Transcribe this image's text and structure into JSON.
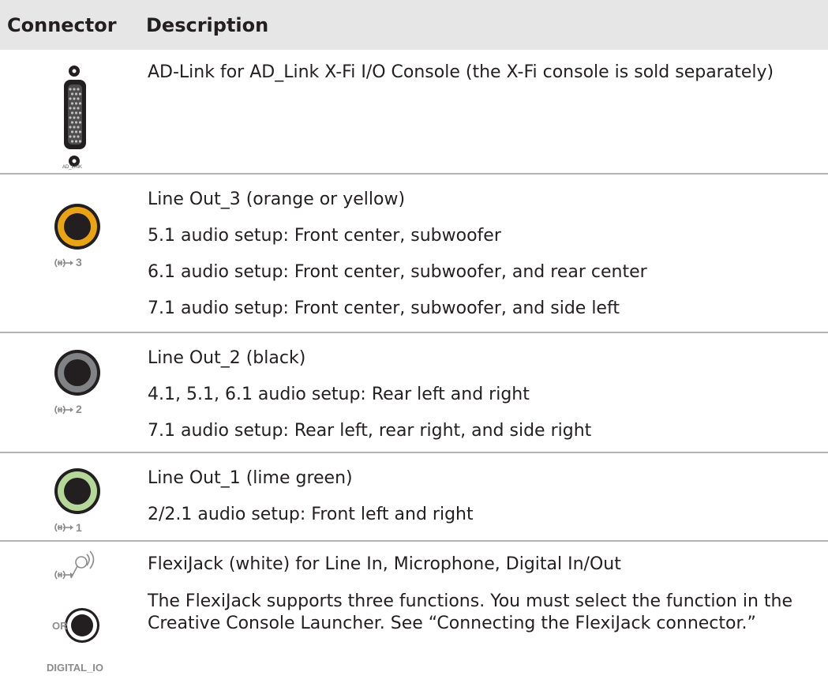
{
  "header": {
    "col_connector": "Connector",
    "col_description": "Description"
  },
  "rows": [
    {
      "icon": "ad-link-connector-icon",
      "icon_label": "AD_LINK",
      "lines": [
        "AD-Link for AD_Link X-Fi I/O Console (the X-Fi console is sold separately)"
      ]
    },
    {
      "icon": "line-out-3-jack-icon",
      "icon_label": "3",
      "jack_color": "#e8a317",
      "lines": [
        "Line Out_3 (orange or yellow)",
        "5.1 audio setup: Front center, subwoofer",
        "6.1 audio setup: Front center, subwoofer, and rear center",
        "7.1 audio setup: Front center, subwoofer, and side left"
      ]
    },
    {
      "icon": "line-out-2-jack-icon",
      "icon_label": "2",
      "jack_color": "#6d6e70",
      "lines": [
        "Line Out_2 (black)",
        "4.1, 5.1, 6.1 audio setup: Rear left and right",
        "7.1 audio setup: Rear left, rear right, and side right"
      ]
    },
    {
      "icon": "line-out-1-jack-icon",
      "icon_label": "1",
      "jack_color": "#b5d89a",
      "lines": [
        "Line Out_1 (lime green)",
        "2/2.1 audio setup: Front left and right"
      ]
    },
    {
      "icon": "flexijack-icon",
      "icon_label": "DIGITAL_IO",
      "icon_or": "OR",
      "lines": [
        "FlexiJack (white) for Line In, Microphone, Digital In/Out",
        "The FlexiJack supports three functions. You must select the function in the",
        "Creative Console Launcher. See “Connecting the FlexiJack connector.”"
      ]
    }
  ]
}
